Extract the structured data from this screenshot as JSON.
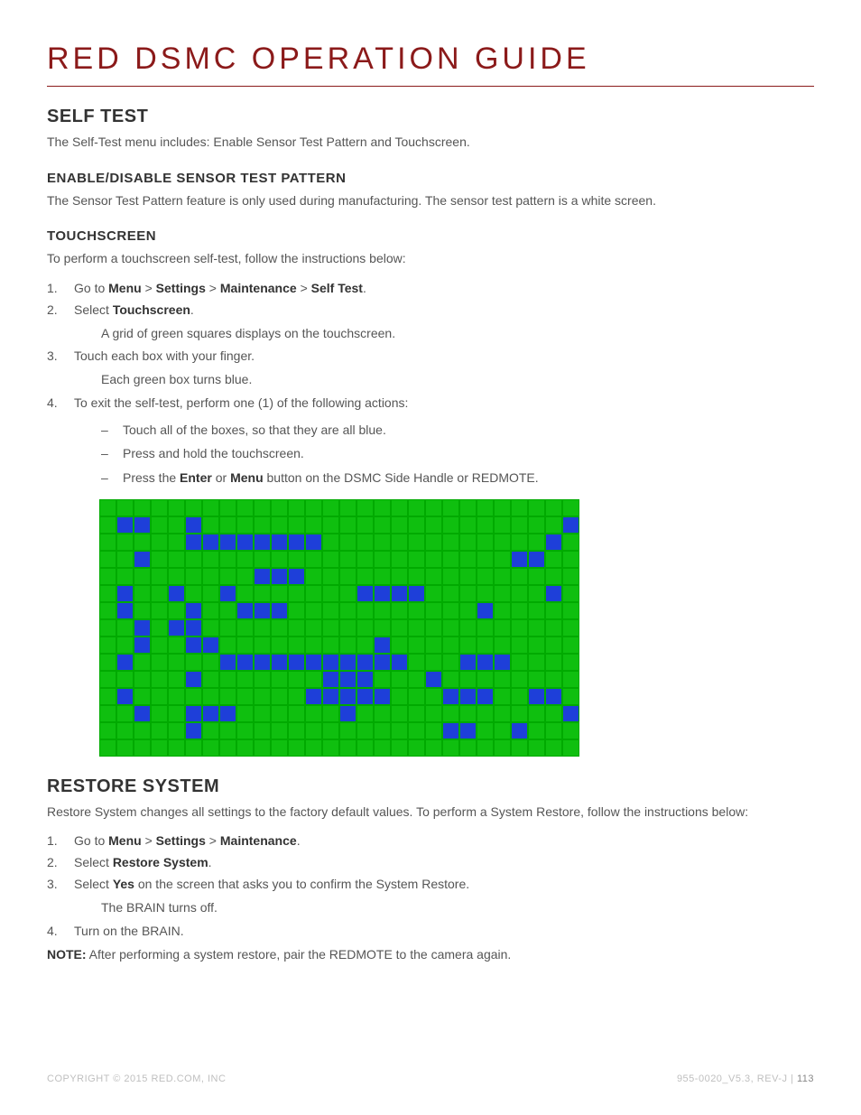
{
  "header": {
    "title": "RED DSMC OPERATION GUIDE"
  },
  "selftest": {
    "heading": "SELF TEST",
    "intro": "The Self-Test menu includes: Enable Sensor Test Pattern and Touchscreen."
  },
  "sensor": {
    "heading": "ENABLE/DISABLE SENSOR TEST PATTERN",
    "body": "The Sensor Test Pattern feature is only used during manufacturing. The sensor test pattern is a white screen."
  },
  "touch": {
    "heading": "TOUCHSCREEN",
    "lead": "To perform a touchscreen self-test, follow the instructions below:",
    "step1_pre": "Go to ",
    "menu": "Menu",
    "gt": " > ",
    "settings": "Settings",
    "maint": "Maintenance",
    "st": "Self Test",
    "period": ".",
    "step2_pre": "Select ",
    "step2_bold": "Touchscreen",
    "step2_post": ".",
    "step2_note": "A grid of green squares displays on the touchscreen.",
    "step3": "Touch each box with your finger.",
    "step3_note": "Each green box turns blue.",
    "step4": "To exit the self-test, perform one (1) of the following actions:",
    "sub1": "Touch all of the boxes, so that they are all blue.",
    "sub2": "Press and hold the touchscreen.",
    "sub3_pre": "Press the ",
    "sub3_b1": "Enter",
    "sub3_mid": " or ",
    "sub3_b2": "Menu",
    "sub3_post": " button on the DSMC Side Handle or REDMOTE."
  },
  "restore": {
    "heading": "RESTORE SYSTEM",
    "intro": "Restore System changes all settings to the factory default values. To perform a System Restore, follow the instructions below:",
    "s1_pre": "Go to ",
    "s1_b1": "Menu",
    "s1_gt": " > ",
    "s1_b2": "Settings",
    "s1_b3": "Maintenance",
    "s1_post": ".",
    "s2_pre": "Select ",
    "s2_b": "Restore System",
    "s2_post": ".",
    "s3_pre": "Select ",
    "s3_b": "Yes",
    "s3_post": " on the screen that asks you to confirm the System Restore.",
    "s3_note": "The BRAIN turns off.",
    "s4": "Turn on the BRAIN.",
    "note_b": "NOTE:",
    "note": " After performing a system restore, pair the REDMOTE to the camera again."
  },
  "grid_rows": [
    "gggggggggggggggggggggggggggg",
    "gbbggbgggggggggggggggggggggb",
    "gggggbbbbbbbbgggggggggggggbg",
    "ggbgggggggggggggggggggggbbgg",
    "gggggggggbbbgggggggggggggggg",
    "gbggbggbgggggggbbbbgggggggbg",
    "gbgggbggbbbgggggggggggbggggg",
    "ggbgbbgggggggggggggggggggggg",
    "ggbggbbgggggggggbggggggggggg",
    "gbgggggbbbbbbbbbbbgggbbbgggg",
    "gggggbgggggggbbbgggbgggggggg",
    "gbggggggggggbbbbbgggbbbggbbg",
    "ggbggbbbggggggbggggggggggggb",
    "gggggbggggggggggggggbbggbggg",
    "gggggggggggggggggggggggggggg"
  ],
  "footer": {
    "left": "COPYRIGHT © 2015 RED.COM, INC",
    "right_doc": "955-0020_V5.3, REV-J",
    "sep": "  |  ",
    "page": "113"
  }
}
